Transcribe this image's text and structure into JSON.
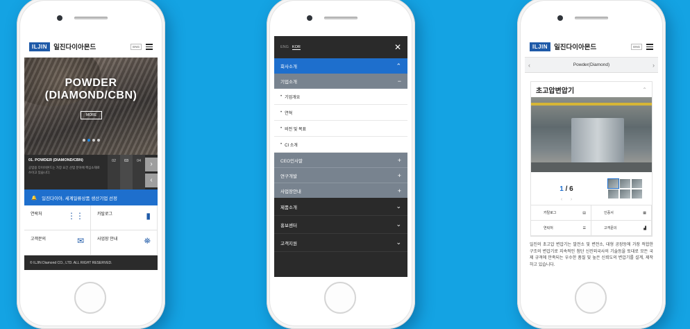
{
  "header": {
    "logo": "ILJIN",
    "brand": "일진다이아몬드",
    "lang_badge": "ENG"
  },
  "home": {
    "hero_title": "POWDER\n(DIAMOND/CBN)",
    "more_label": "MORE",
    "slide_caption_title": "01. POWDER (DIAMOND/CBN)",
    "slide_caption_text": "공업용 다이아몬드는 가장 요긴 산업 분야에 핵심소재로 쓰이고 있습니다.",
    "slide_numbers": [
      "02",
      "03",
      "04"
    ],
    "notice": "일진다이아, 세계일류상품 생산기업 선정",
    "quick_links": [
      {
        "label": "연락처",
        "icon": "phone-icon"
      },
      {
        "label": "카탈로그",
        "icon": "catalog-icon"
      },
      {
        "label": "고객문의",
        "icon": "mail-icon"
      },
      {
        "label": "사업장 안내",
        "icon": "map-icon"
      }
    ],
    "footer": "© ILJIN Diamond CO., LTD. ALL RIGHT RESERVED."
  },
  "menu": {
    "langs": [
      "ENG",
      "KOR"
    ],
    "sections": [
      {
        "label": "회사소개",
        "type": "blue",
        "toggle": "⌃"
      },
      {
        "label": "기업소개",
        "type": "grey",
        "toggle": "−"
      },
      {
        "label": "기업개요",
        "type": "sub"
      },
      {
        "label": "연혁",
        "type": "sub"
      },
      {
        "label": "비전 및 목표",
        "type": "sub"
      },
      {
        "label": "CI 소개",
        "type": "sub"
      },
      {
        "label": "CEO인사말",
        "type": "grey",
        "toggle": "+"
      },
      {
        "label": "연구개발",
        "type": "grey",
        "toggle": "+"
      },
      {
        "label": "사업장안내",
        "type": "grey",
        "toggle": "+"
      },
      {
        "label": "제품소개",
        "type": "dark",
        "toggle": "⌄"
      },
      {
        "label": "홍보센터",
        "type": "dark",
        "toggle": "⌄"
      },
      {
        "label": "고객지원",
        "type": "dark",
        "toggle": "⌄"
      }
    ]
  },
  "product": {
    "breadcrumb": "Powder(Diamond)",
    "card_title": "초고압변압기",
    "page_current": "1",
    "page_sep": " / ",
    "page_total": "6",
    "links": [
      {
        "label": "카탈로그",
        "icon": "print-icon"
      },
      {
        "label": "인증서",
        "icon": "certificate-icon"
      },
      {
        "label": "연락처",
        "icon": "contact-icon"
      },
      {
        "label": "고객문의",
        "icon": "inquiry-icon"
      }
    ],
    "description": "일진의 초고압 변압기는 발전소 및 변전소, 대형 공장등에 가장 적합한 구조의 변압기로 지속적인 첨단 신진외국사의 기술등을 토대로 모든 국제 규격에 만족되는 우수한 품질 및 높은 신뢰도의 변압기를 설계, 제작하고 있습니다."
  }
}
